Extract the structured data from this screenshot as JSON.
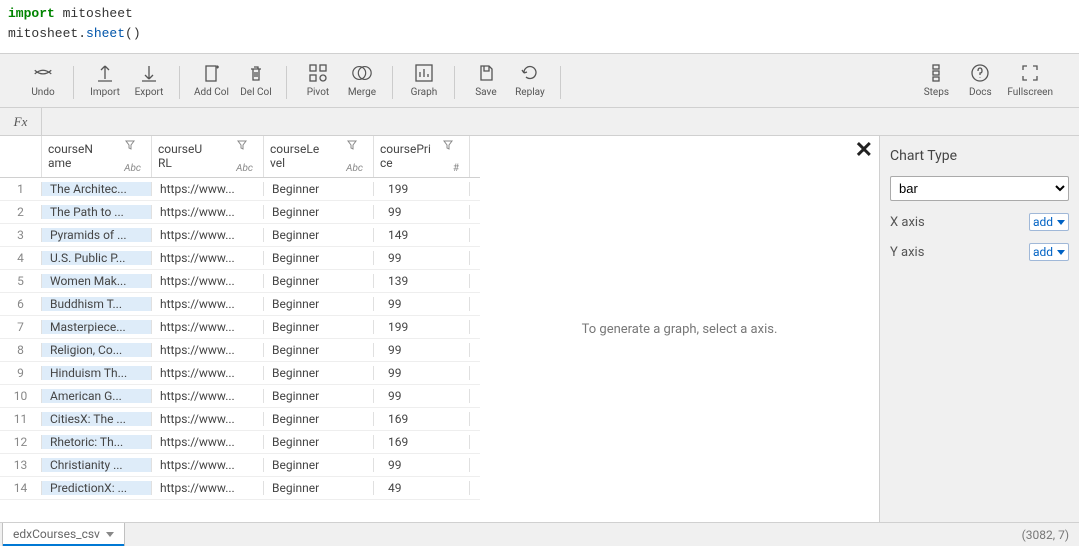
{
  "code": {
    "line1_kw": "import",
    "line1_mod": "mitosheet",
    "line2_mod": "mitosheet",
    "line2_fn": "sheet",
    "line2_paren": "()"
  },
  "toolbar": {
    "undo": "Undo",
    "import": "Import",
    "export": "Export",
    "addcol": "Add Col",
    "delcol": "Del Col",
    "pivot": "Pivot",
    "merge": "Merge",
    "graph": "Graph",
    "save": "Save",
    "replay": "Replay",
    "steps": "Steps",
    "docs": "Docs",
    "fullscreen": "Fullscreen"
  },
  "fx_label": "Fx",
  "columns": [
    {
      "name_l1": "courseN",
      "name_l2": "ame",
      "type": "Abc"
    },
    {
      "name_l1": "courseU",
      "name_l2": "RL",
      "type": "Abc"
    },
    {
      "name_l1": "courseLe",
      "name_l2": "vel",
      "type": "Abc"
    },
    {
      "name_l1": "coursePri",
      "name_l2": "ce",
      "type": "#"
    }
  ],
  "rows": [
    {
      "n": "1",
      "name": "The Architec...",
      "url": "https://www...",
      "level": "Beginner",
      "price": "199"
    },
    {
      "n": "2",
      "name": "The Path to ...",
      "url": "https://www...",
      "level": "Beginner",
      "price": "99"
    },
    {
      "n": "3",
      "name": "Pyramids of ...",
      "url": "https://www...",
      "level": "Beginner",
      "price": "149"
    },
    {
      "n": "4",
      "name": "U.S. Public P...",
      "url": "https://www...",
      "level": "Beginner",
      "price": "99"
    },
    {
      "n": "5",
      "name": "Women Mak...",
      "url": "https://www...",
      "level": "Beginner",
      "price": "139"
    },
    {
      "n": "6",
      "name": "Buddhism T...",
      "url": "https://www...",
      "level": "Beginner",
      "price": "99"
    },
    {
      "n": "7",
      "name": "Masterpiece...",
      "url": "https://www...",
      "level": "Beginner",
      "price": "199"
    },
    {
      "n": "8",
      "name": "Religion, Co...",
      "url": "https://www...",
      "level": "Beginner",
      "price": "99"
    },
    {
      "n": "9",
      "name": "Hinduism Th...",
      "url": "https://www...",
      "level": "Beginner",
      "price": "99"
    },
    {
      "n": "10",
      "name": "American G...",
      "url": "https://www...",
      "level": "Beginner",
      "price": "99"
    },
    {
      "n": "11",
      "name": "CitiesX: The ...",
      "url": "https://www...",
      "level": "Beginner",
      "price": "169"
    },
    {
      "n": "12",
      "name": "Rhetoric: Th...",
      "url": "https://www...",
      "level": "Beginner",
      "price": "169"
    },
    {
      "n": "13",
      "name": "Christianity ...",
      "url": "https://www...",
      "level": "Beginner",
      "price": "99"
    },
    {
      "n": "14",
      "name": "PredictionX: ...",
      "url": "https://www...",
      "level": "Beginner",
      "price": "49"
    }
  ],
  "graph_placeholder": "To generate a graph, select a axis.",
  "chart_config": {
    "title": "Chart Type",
    "select_value": "bar",
    "xaxis_label": "X axis",
    "yaxis_label": "Y axis",
    "add_label": "add"
  },
  "sheet_tab": "edxCourses_csv",
  "footer_info": "(3082, 7)"
}
